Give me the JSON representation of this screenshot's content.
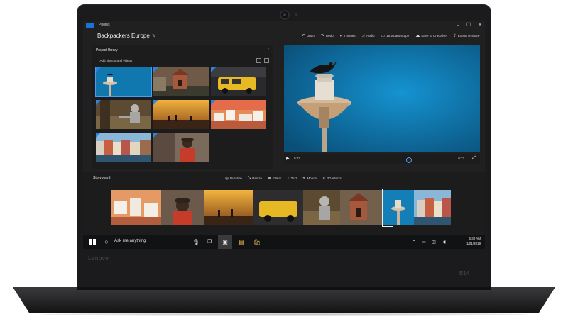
{
  "device": {
    "bezel_logo": "Lenovo",
    "model": "E14"
  },
  "window": {
    "app_name": "Photos",
    "controls": [
      "–",
      "☐",
      "✕"
    ]
  },
  "project": {
    "title": "Backpackers Europe"
  },
  "commands": [
    {
      "label": "Undo",
      "icon": "undo-icon"
    },
    {
      "label": "Redo",
      "icon": "redo-icon"
    },
    {
      "label": "Themes",
      "icon": "themes-icon"
    },
    {
      "label": "Audio",
      "icon": "audio-icon"
    },
    {
      "label": "16:9 Landscape",
      "icon": "aspect-ratio-icon"
    },
    {
      "label": "Save to OneDrive",
      "icon": "cloud-icon"
    },
    {
      "label": "Export or share",
      "icon": "export-icon"
    }
  ],
  "library": {
    "title": "Project library",
    "add_label": "Add photos and videos",
    "thumbnails": [
      "lighthouse bird",
      "brick building",
      "yellow van",
      "hiker on rocks",
      "sunset group",
      "island village",
      "harbor houses",
      "traveller with hat"
    ]
  },
  "player": {
    "current_time": "0:22",
    "end_time": "0:22",
    "progress": 0.71
  },
  "storyboard": {
    "title": "Storyboard",
    "tools": [
      {
        "label": "Duration",
        "icon": "clock-icon"
      },
      {
        "label": "Resize",
        "icon": "resize-icon"
      },
      {
        "label": "Filters",
        "icon": "filters-icon"
      },
      {
        "label": "Text",
        "icon": "text-icon"
      },
      {
        "label": "Motion",
        "icon": "motion-icon"
      },
      {
        "label": "3D effects",
        "icon": "3d-effects-icon"
      }
    ]
  },
  "taskbar": {
    "search_placeholder": "Ask me anything",
    "time": "6:30 AM",
    "date": "1/01/2019"
  },
  "colors": {
    "accent": "#2b84e0",
    "background": "#202020",
    "panel": "#1c1c1c",
    "taskbar": "#111214"
  }
}
